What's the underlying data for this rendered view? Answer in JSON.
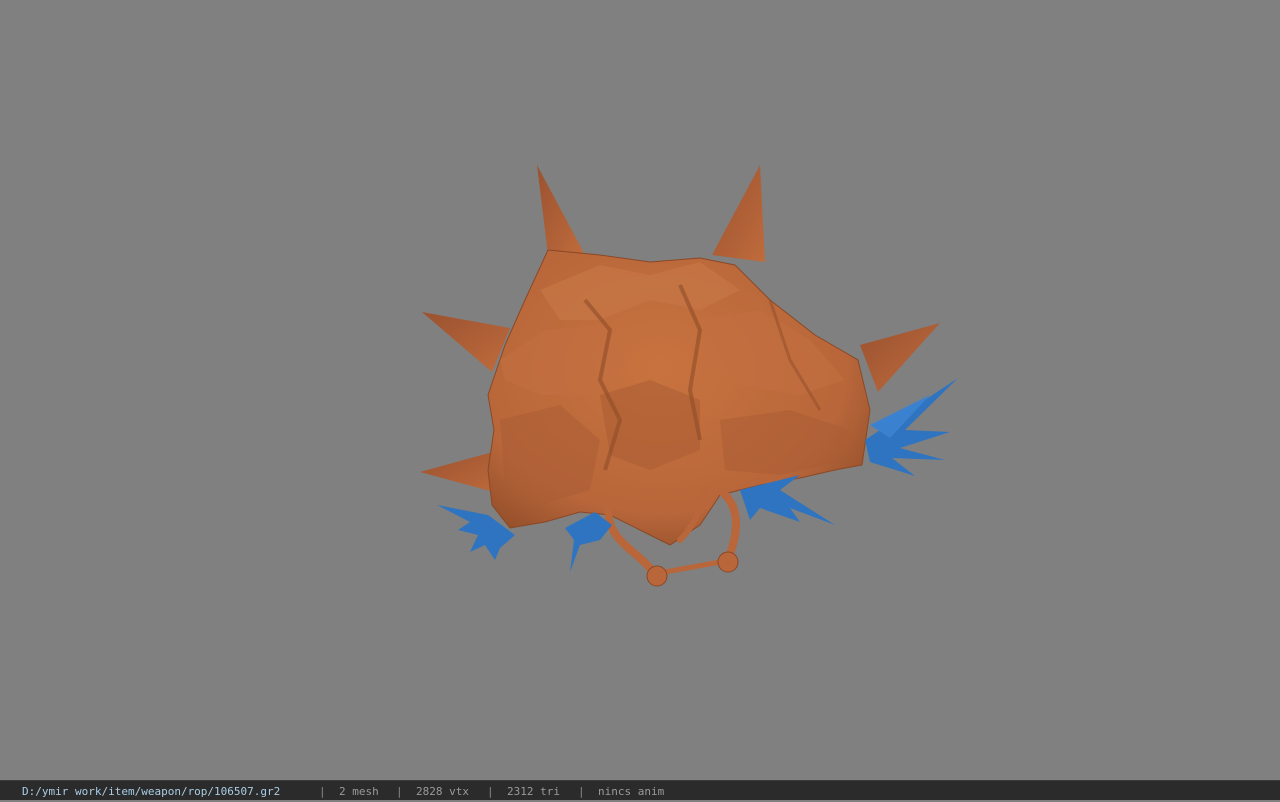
{
  "viewport": {
    "background_color": "#808080",
    "model": {
      "body_color": "#b8663a",
      "body_shadow_color": "#8f4c28",
      "body_highlight_color": "#cf7a48",
      "feather_color": "#2f74c0",
      "feather_dark_color": "#1e4f8f"
    }
  },
  "status_bar": {
    "path": "D:/ymir work/item/weapon/rop/106507.gr2",
    "separator": "|",
    "mesh": "2 mesh",
    "vertices": "2828 vtx",
    "triangles": "2312 tri",
    "animation": "nincs anim"
  }
}
